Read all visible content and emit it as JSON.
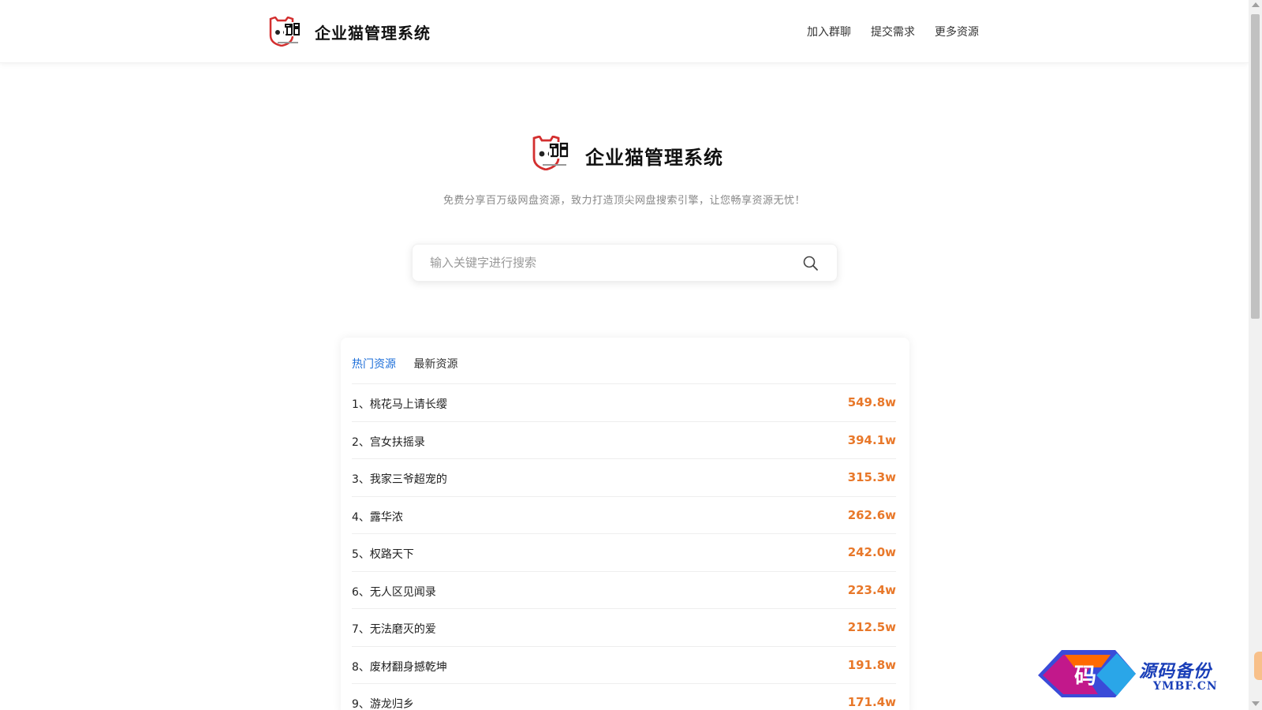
{
  "header": {
    "title": "企业猫管理系统",
    "nav": [
      "加入群聊",
      "提交需求",
      "更多资源"
    ]
  },
  "hero": {
    "title": "企业猫管理系统",
    "subtitle": "免费分享百万级网盘资源，致力打造顶尖网盘搜索引擎，让您畅享资源无忧！"
  },
  "search": {
    "placeholder": "输入关键字进行搜索",
    "value": ""
  },
  "tabs": [
    "热门资源",
    "最新资源"
  ],
  "active_tab": "热门资源",
  "list": [
    {
      "title": "1、桃花马上请长缨",
      "count": "549.8w"
    },
    {
      "title": "2、宫女扶摇录",
      "count": "394.1w"
    },
    {
      "title": "3、我家三爷超宠的",
      "count": "315.3w"
    },
    {
      "title": "4、露华浓",
      "count": "262.6w"
    },
    {
      "title": "5、权路天下",
      "count": "242.0w"
    },
    {
      "title": "6、无人区见闻录",
      "count": "223.4w"
    },
    {
      "title": "7、无法磨灭的爱",
      "count": "212.5w"
    },
    {
      "title": "8、废材翻身撼乾坤",
      "count": "191.8w"
    },
    {
      "title": "9、游龙归乡",
      "count": "171.4w"
    }
  ],
  "watermark": {
    "cn": "源码备份",
    "en": "YMBF.CN",
    "glyph": "码"
  },
  "colors": {
    "accent": "#1e6fd9",
    "count": "#e8782a",
    "logo_red": "#d32f2f"
  }
}
